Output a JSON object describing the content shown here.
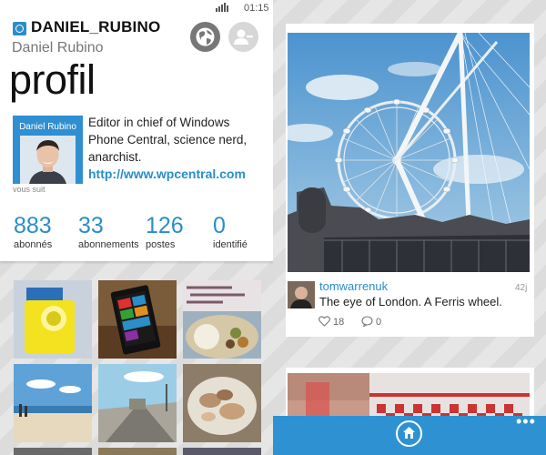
{
  "status": {
    "time": "01:15",
    "signal_icon": "signal-icon"
  },
  "profile": {
    "username": "DANIEL_RUBINO",
    "full_name": "Daniel Rubino",
    "page_title": "profil",
    "avatar_label": "Daniel Rubino",
    "follows_label": "vous suit",
    "bio": "Editor in chief of Windows Phone Central, science nerd, anarchist.",
    "website": "http://www.wpcentral.com",
    "actions": {
      "globe_icon": "globe-icon",
      "user_icon": "remove-user-icon"
    }
  },
  "stats": [
    {
      "value": "883",
      "label": "abonnés"
    },
    {
      "value": "33",
      "label": "abonnements"
    },
    {
      "value": "126",
      "label": "postes"
    },
    {
      "value": "0",
      "label": "identifié"
    }
  ],
  "post": {
    "author": "tomwarrenuk",
    "time": "42j",
    "caption": "The eye of London. A Ferris wheel.",
    "likes": "18",
    "comments": "0"
  },
  "app_bar": {
    "home_icon": "home-icon",
    "more_label": "•••"
  },
  "colors": {
    "accent": "#2a8ec9",
    "app_bar": "#2e92d2"
  }
}
